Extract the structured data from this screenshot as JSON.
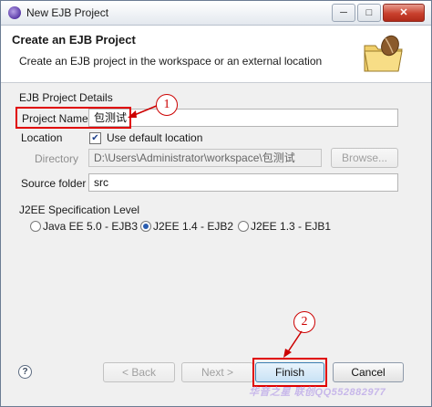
{
  "window": {
    "title": "New EJB Project",
    "controls": {
      "minimize": "─",
      "maximize": "□",
      "close": "✕"
    }
  },
  "header": {
    "title": "Create an EJB Project",
    "description": "Create an EJB project in the workspace or an external location",
    "icon": "folder-with-bean-icon"
  },
  "details": {
    "group_label": "EJB Project Details",
    "project_name_label": "Project Name",
    "project_name_value": "包测试",
    "location_label": "Location",
    "use_default_location": "Use default location",
    "use_default_checked": true,
    "directory_label": "Directory",
    "directory_value": "D:\\Users\\Administrator\\workspace\\包测试",
    "browse_label": "Browse...",
    "source_folder_label": "Source folder",
    "source_folder_value": "src"
  },
  "spec": {
    "group_label": "J2EE Specification Level",
    "options": [
      {
        "label": "Java EE 5.0 - EJB3",
        "selected": false
      },
      {
        "label": "J2EE 1.4 - EJB2",
        "selected": true
      },
      {
        "label": "J2EE 1.3 - EJB1",
        "selected": false
      }
    ]
  },
  "annotations": {
    "callout1": "1",
    "callout2": "2",
    "color": "#e00000"
  },
  "footer": {
    "help_icon": "?",
    "back_label": "< Back",
    "next_label": "Next >",
    "finish_label": "Finish",
    "cancel_label": "Cancel"
  },
  "watermark": "华音之星 联创QQ552882977"
}
